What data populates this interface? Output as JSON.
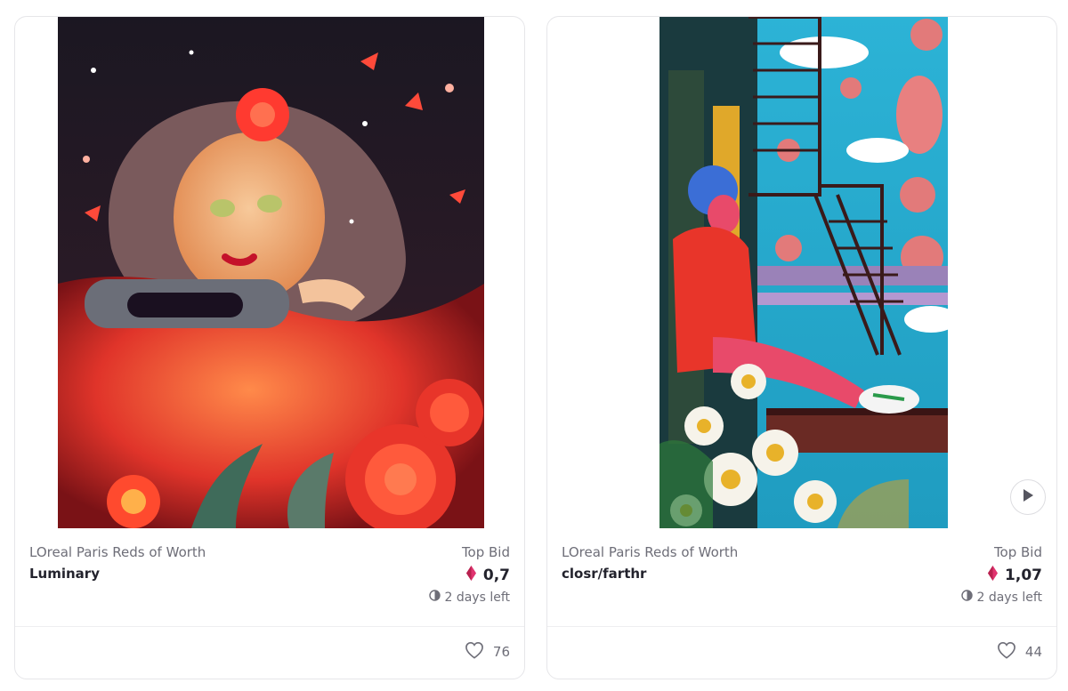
{
  "cards": [
    {
      "collection": "LOreal Paris Reds of Worth",
      "artist": "Luminary",
      "bid_label": "Top Bid",
      "bid_value": "0,7",
      "time_left": "2 days left",
      "likes": "76",
      "has_play_button": false
    },
    {
      "collection": "LOreal Paris Reds of Worth",
      "artist": "closr/farthr",
      "bid_label": "Top Bid",
      "bid_value": "1,07",
      "time_left": "2 days left",
      "likes": "44",
      "has_play_button": true
    }
  ],
  "icons": {
    "currency": "eth-diamond-icon",
    "timer": "clock-icon",
    "like": "heart-icon",
    "play": "play-icon"
  },
  "colors": {
    "accent_eth": "#e0336f",
    "text_primary": "#23232d",
    "text_secondary": "#6e6e78",
    "card_border": "#e6e6e9"
  }
}
